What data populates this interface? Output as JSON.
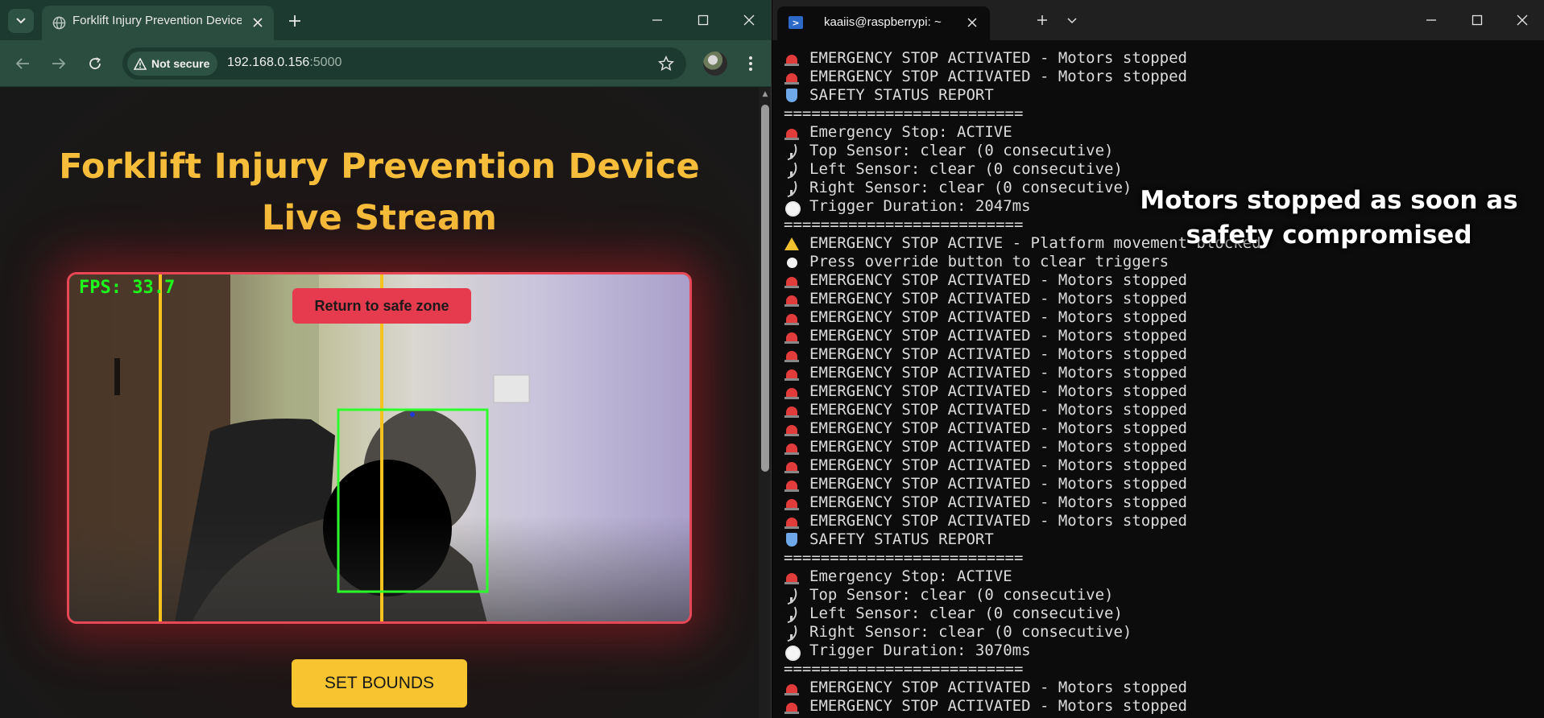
{
  "browser": {
    "tab_title": "Forklift Injury Prevention Device",
    "security_label": "Not secure",
    "url_host": "192.168.0.156",
    "url_port": ":5000",
    "icons": {
      "tab_search": "chevron-down-icon",
      "favicon": "globe-icon",
      "back": "arrow-left-icon",
      "forward": "arrow-right-icon",
      "reload": "reload-icon",
      "warning": "warning-triangle-icon",
      "bookmark": "star-icon",
      "menu": "three-dots-icon"
    }
  },
  "page": {
    "heading": "Forklift Injury Prevention Device Live Stream",
    "fps_label": "FPS: 33.7",
    "safe_zone_button": "Return to safe zone",
    "set_bounds_button": "SET BOUNDS",
    "colors": {
      "heading": "#f5bd3a",
      "frame_border": "#e84855",
      "alert_button": "#e63a4e",
      "set_bounds": "#f8c42f",
      "detection_box": "#2bff2b",
      "boundary_line": "#f6c21e"
    }
  },
  "terminal": {
    "tab_title": "kaaiis@raspberrypi: ~",
    "lines": [
      {
        "icon": "siren",
        "text": "EMERGENCY STOP ACTIVATED - Motors stopped"
      },
      {
        "icon": "siren",
        "text": "EMERGENCY STOP ACTIVATED - Motors stopped"
      },
      {
        "icon": "shield",
        "text": "SAFETY STATUS REPORT"
      },
      {
        "icon": "",
        "text": "=========================="
      },
      {
        "icon": "siren",
        "text": "Emergency Stop: ACTIVE"
      },
      {
        "icon": "dish",
        "text": "Top Sensor: clear (0 consecutive)"
      },
      {
        "icon": "dish",
        "text": "Left Sensor: clear (0 consecutive)"
      },
      {
        "icon": "dish",
        "text": "Right Sensor: clear (0 consecutive)"
      },
      {
        "icon": "clock",
        "text": "Trigger Duration: 2047ms"
      },
      {
        "icon": "",
        "text": "=========================="
      },
      {
        "icon": "warn",
        "text": "EMERGENCY STOP ACTIVE - Platform movement blocked"
      },
      {
        "icon": "circle",
        "text": "Press override button to clear triggers"
      },
      {
        "icon": "siren",
        "text": "EMERGENCY STOP ACTIVATED - Motors stopped"
      },
      {
        "icon": "siren",
        "text": "EMERGENCY STOP ACTIVATED - Motors stopped"
      },
      {
        "icon": "siren",
        "text": "EMERGENCY STOP ACTIVATED - Motors stopped"
      },
      {
        "icon": "siren",
        "text": "EMERGENCY STOP ACTIVATED - Motors stopped"
      },
      {
        "icon": "siren",
        "text": "EMERGENCY STOP ACTIVATED - Motors stopped"
      },
      {
        "icon": "siren",
        "text": "EMERGENCY STOP ACTIVATED - Motors stopped"
      },
      {
        "icon": "siren",
        "text": "EMERGENCY STOP ACTIVATED - Motors stopped"
      },
      {
        "icon": "siren",
        "text": "EMERGENCY STOP ACTIVATED - Motors stopped"
      },
      {
        "icon": "siren",
        "text": "EMERGENCY STOP ACTIVATED - Motors stopped"
      },
      {
        "icon": "siren",
        "text": "EMERGENCY STOP ACTIVATED - Motors stopped"
      },
      {
        "icon": "siren",
        "text": "EMERGENCY STOP ACTIVATED - Motors stopped"
      },
      {
        "icon": "siren",
        "text": "EMERGENCY STOP ACTIVATED - Motors stopped"
      },
      {
        "icon": "siren",
        "text": "EMERGENCY STOP ACTIVATED - Motors stopped"
      },
      {
        "icon": "siren",
        "text": "EMERGENCY STOP ACTIVATED - Motors stopped"
      },
      {
        "icon": "shield",
        "text": "SAFETY STATUS REPORT"
      },
      {
        "icon": "",
        "text": "=========================="
      },
      {
        "icon": "siren",
        "text": "Emergency Stop: ACTIVE"
      },
      {
        "icon": "dish",
        "text": "Top Sensor: clear (0 consecutive)"
      },
      {
        "icon": "dish",
        "text": "Left Sensor: clear (0 consecutive)"
      },
      {
        "icon": "dish",
        "text": "Right Sensor: clear (0 consecutive)"
      },
      {
        "icon": "clock",
        "text": "Trigger Duration: 3070ms"
      },
      {
        "icon": "",
        "text": "=========================="
      },
      {
        "icon": "siren",
        "text": "EMERGENCY STOP ACTIVATED - Motors stopped"
      },
      {
        "icon": "siren",
        "text": "EMERGENCY STOP ACTIVATED - Motors stopped"
      }
    ]
  },
  "overlay": {
    "caption": "Motors stopped as soon as safety compromised"
  }
}
